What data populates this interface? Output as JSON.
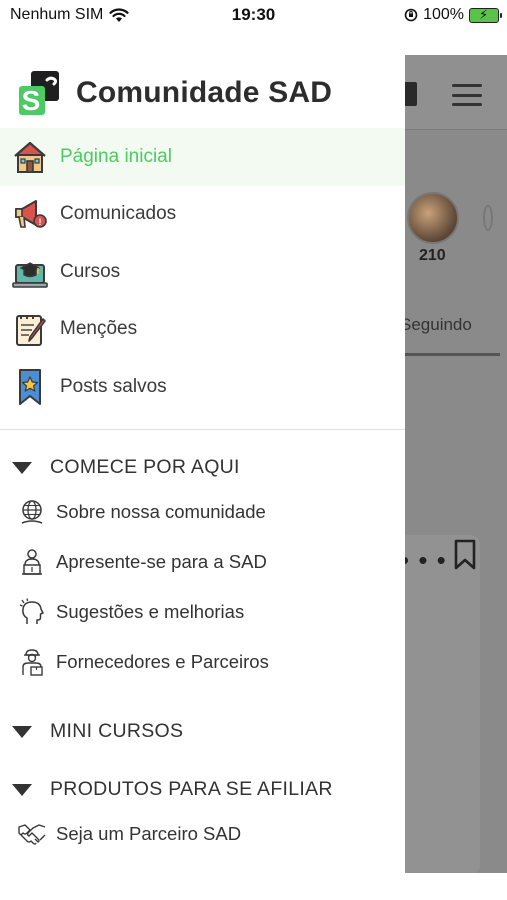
{
  "status_bar": {
    "carrier": "Nenhum SIM",
    "time": "19:30",
    "battery": "100%"
  },
  "background": {
    "follower_count": "210",
    "tab_label": "Seguindo"
  },
  "drawer": {
    "brand": "Comunidade SAD",
    "accent_color": "#4fc964",
    "nav": [
      {
        "label": "Página inicial",
        "icon": "house-icon",
        "active": true
      },
      {
        "label": "Comunicados",
        "icon": "megaphone-icon"
      },
      {
        "label": "Cursos",
        "icon": "graduation-laptop-icon"
      },
      {
        "label": "Menções",
        "icon": "notepad-pencil-icon"
      },
      {
        "label": "Posts salvos",
        "icon": "star-bookmark-icon"
      }
    ],
    "sections": [
      {
        "label": "COMECE POR AQUI",
        "items": [
          {
            "label": "Sobre nossa comunidade",
            "icon": "globe-icon"
          },
          {
            "label": "Apresente-se para a SAD",
            "icon": "speaker-podium-icon"
          },
          {
            "label": "Sugestões e melhorias",
            "icon": "head-idea-icon"
          },
          {
            "label": "Fornecedores e Parceiros",
            "icon": "delivery-person-icon"
          }
        ]
      },
      {
        "label": "MINI CURSOS",
        "items": []
      },
      {
        "label": "PRODUTOS PARA SE AFILIAR",
        "items": [
          {
            "label": "Seja um Parceiro SAD",
            "icon": "handshake-icon"
          }
        ]
      }
    ]
  }
}
